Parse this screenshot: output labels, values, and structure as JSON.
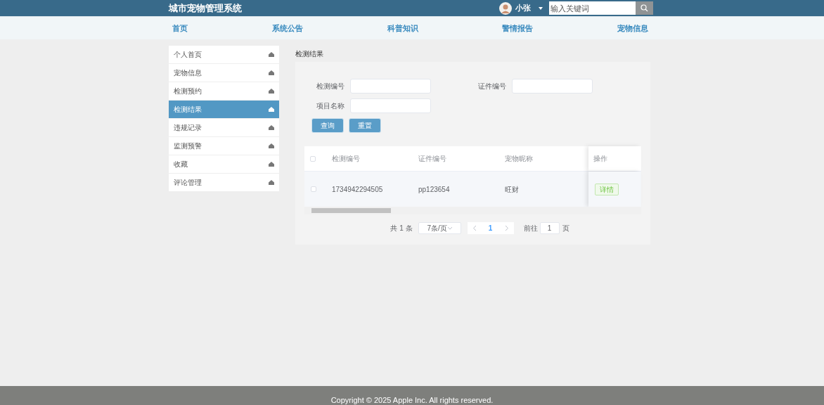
{
  "header": {
    "title": "城市宠物管理系统",
    "user": "小张",
    "search": {
      "placeholder": "输入关键词"
    }
  },
  "nav": [
    {
      "label": "首页"
    },
    {
      "label": "系统公告"
    },
    {
      "label": "科普知识"
    },
    {
      "label": "警情报告"
    },
    {
      "label": "宠物信息"
    }
  ],
  "sidebar": {
    "items": [
      {
        "label": "个人首页",
        "selected": false
      },
      {
        "label": "宠物信息",
        "selected": false
      },
      {
        "label": "检测预约",
        "selected": false
      },
      {
        "label": "检测结果",
        "selected": true
      },
      {
        "label": "违规记录",
        "selected": false
      },
      {
        "label": "监测预警",
        "selected": false
      },
      {
        "label": "收藏",
        "selected": false
      },
      {
        "label": "评论管理",
        "selected": false
      }
    ]
  },
  "breadcrumb": "检测结果",
  "filters": [
    {
      "label": "检测编号"
    },
    {
      "label": "证件编号"
    },
    {
      "label": "项目名称"
    }
  ],
  "buttons": [
    {
      "label": "查询"
    },
    {
      "label": "重置"
    }
  ],
  "table": {
    "all_checked": false,
    "columns": [
      "检测编号",
      "证件编号",
      "宠物昵称",
      "操作"
    ],
    "rows": [
      {
        "checked": false,
        "cells": [
          "1734942294505",
          "pp123654",
          "旺财"
        ],
        "action": "详情"
      }
    ]
  },
  "pagination": {
    "total": "共 1 条",
    "page_size": "7条/页",
    "current": "1",
    "goto_label": "前往",
    "goto_value": "1",
    "page_unit": "页"
  },
  "footer": "Copyright © 2025 Apple Inc. All rights reserved."
}
